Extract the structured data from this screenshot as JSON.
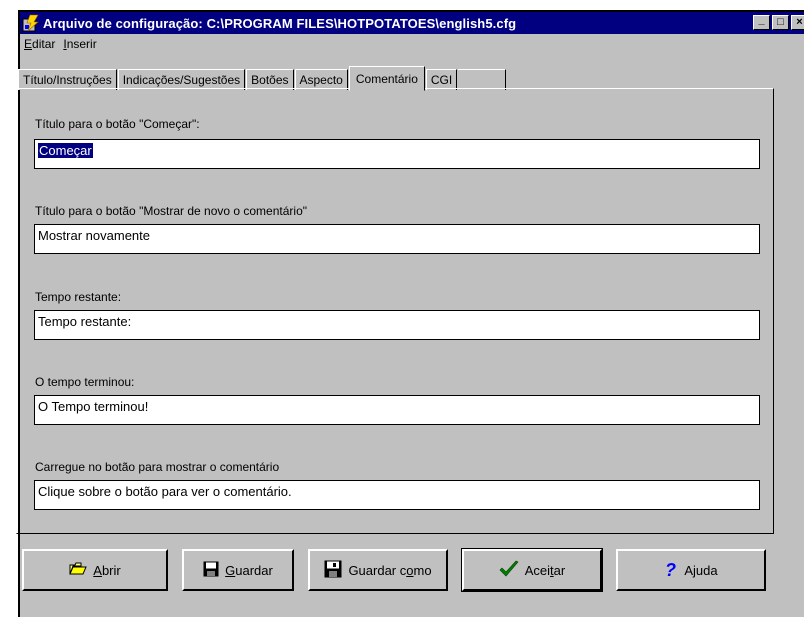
{
  "window": {
    "title": "Arquivo de configuração: C:\\PROGRAM FILES\\HOTPOTATOES\\english5.cfg",
    "controls": [
      "_",
      "□",
      "×"
    ]
  },
  "menu": [
    {
      "key": "E",
      "rest": "ditar"
    },
    {
      "key": "I",
      "rest": "nserir"
    }
  ],
  "tabs": [
    {
      "label": "Título/Instruções",
      "active": false
    },
    {
      "label": "Indicações/Sugestões",
      "active": false
    },
    {
      "label": "Botões",
      "active": false
    },
    {
      "label": "Aspecto",
      "active": false
    },
    {
      "label": "Comentário",
      "active": true
    },
    {
      "label": "CGI",
      "active": false
    }
  ],
  "fields": [
    {
      "label": "Título para o botão \"Começar\":",
      "value": "Começar",
      "selected": true
    },
    {
      "label": "Título para o botão \"Mostrar de novo o comentário\"",
      "value": "Mostrar novamente"
    },
    {
      "label": "Tempo restante:",
      "value": "Tempo restante:"
    },
    {
      "label": "O tempo terminou:",
      "value": "O Tempo terminou!"
    },
    {
      "label": "Carregue no botão para mostrar o comentário",
      "value": "Clique sobre o botão para ver o comentário."
    }
  ],
  "buttons": {
    "open": {
      "pre": "",
      "key": "A",
      "post": "brir",
      "icon": "folder-open-icon"
    },
    "save": {
      "pre": "",
      "key": "G",
      "post": "uardar",
      "icon": "floppy-disk-icon"
    },
    "saveas": {
      "pre": "Guardar c",
      "key": "o",
      "post": "mo",
      "icon": "floppy-save-as-icon"
    },
    "accept": {
      "pre": "Acei",
      "key": "t",
      "post": "ar",
      "icon": "checkmark-icon"
    },
    "help": {
      "pre": "A",
      "key": "j",
      "post": "uda",
      "icon": "question-mark-icon"
    }
  },
  "colors": {
    "titlebar": "#000080",
    "face": "#c0c0c0",
    "check": "#008000",
    "help": "#0000ff"
  }
}
